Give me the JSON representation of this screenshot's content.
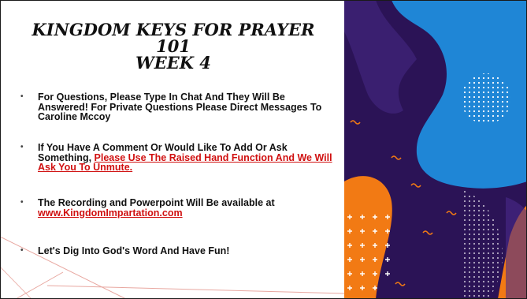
{
  "title": {
    "line1": "KINGDOM KEYS FOR PRAYER",
    "line2": "101",
    "line3": "WEEK 4"
  },
  "bullets": {
    "b1": "For Questions, Please Type In Chat And They Will Be Answered! For Private Questions Please Direct Messages To Caroline Mccoy",
    "b2_plain": "If You Have A Comment Or Would Like To Add Or Ask Something, ",
    "b2_red": "Please Use The Raised Hand Function And We Will Ask You To Unmute.",
    "b3_plain": "The Recording and Powerpoint Will Be available at",
    "b3_link": "www.KingdomImpartation.com",
    "b4": "Let's Dig Into God's Word And Have Fun!"
  },
  "colors": {
    "accent_red": "#d01010",
    "art_bg": "#2b1356",
    "blue_shape": "#1f86d6",
    "orange_shape": "#f27a14",
    "purple_shape": "#4a2a8a",
    "decor_line": "#e8a7a0"
  },
  "icons": {
    "bullet": "small-square-bullet"
  }
}
